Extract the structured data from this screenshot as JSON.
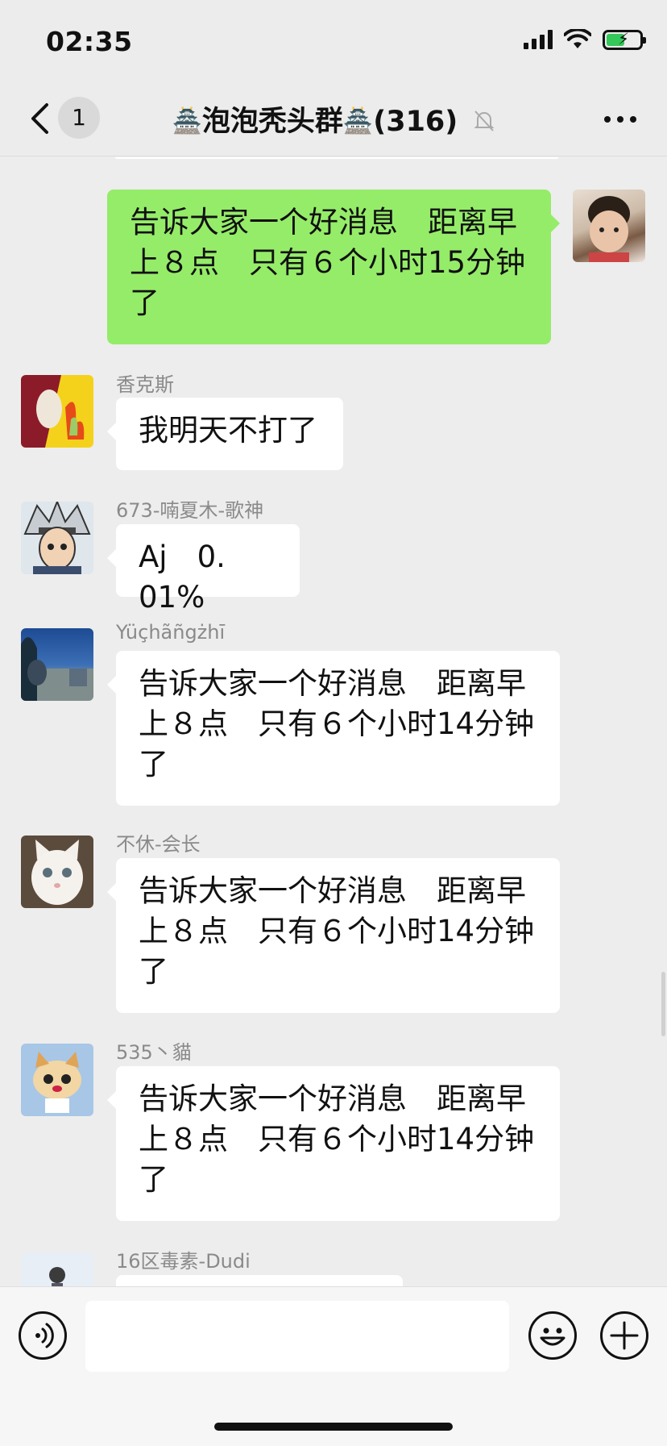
{
  "status_bar": {
    "time": "02:35"
  },
  "nav": {
    "unread_count": "1",
    "title": "泡泡秃头群",
    "member_count": "(316)"
  },
  "messages": [
    {
      "sender": "",
      "mine": true,
      "text": "告诉大家一个好消息　距离早上８点　只有６个小时15分钟了"
    },
    {
      "sender": "香克斯",
      "mine": false,
      "text": "我明天不打了"
    },
    {
      "sender": "673-喃夏木-歌神",
      "mine": false,
      "text": "Aj　0. 01%"
    },
    {
      "sender": "Yüçhãñgżhī",
      "mine": false,
      "text": "告诉大家一个好消息　距离早上８点　只有６个小时14分钟了"
    },
    {
      "sender": "不休-会长",
      "mine": false,
      "text": "告诉大家一个好消息　距离早上８点　只有６个小时14分钟了"
    },
    {
      "sender": "535丶貓",
      "mine": false,
      "text": "告诉大家一个好消息　距离早上８点　只有６个小时14分钟了"
    },
    {
      "sender": "16区毒素-Dudi",
      "mine": false,
      "text": ""
    }
  ],
  "icons": {
    "back": "chevron-left-icon",
    "castle": "castle-emoji-icon",
    "mute": "bell-off-icon",
    "more": "more-dots-icon",
    "voice": "voice-icon",
    "emoji": "smile-icon",
    "plus": "plus-icon"
  },
  "colors": {
    "my_bubble": "#95ec69",
    "other_bubble": "#ffffff",
    "background": "#ededed"
  }
}
